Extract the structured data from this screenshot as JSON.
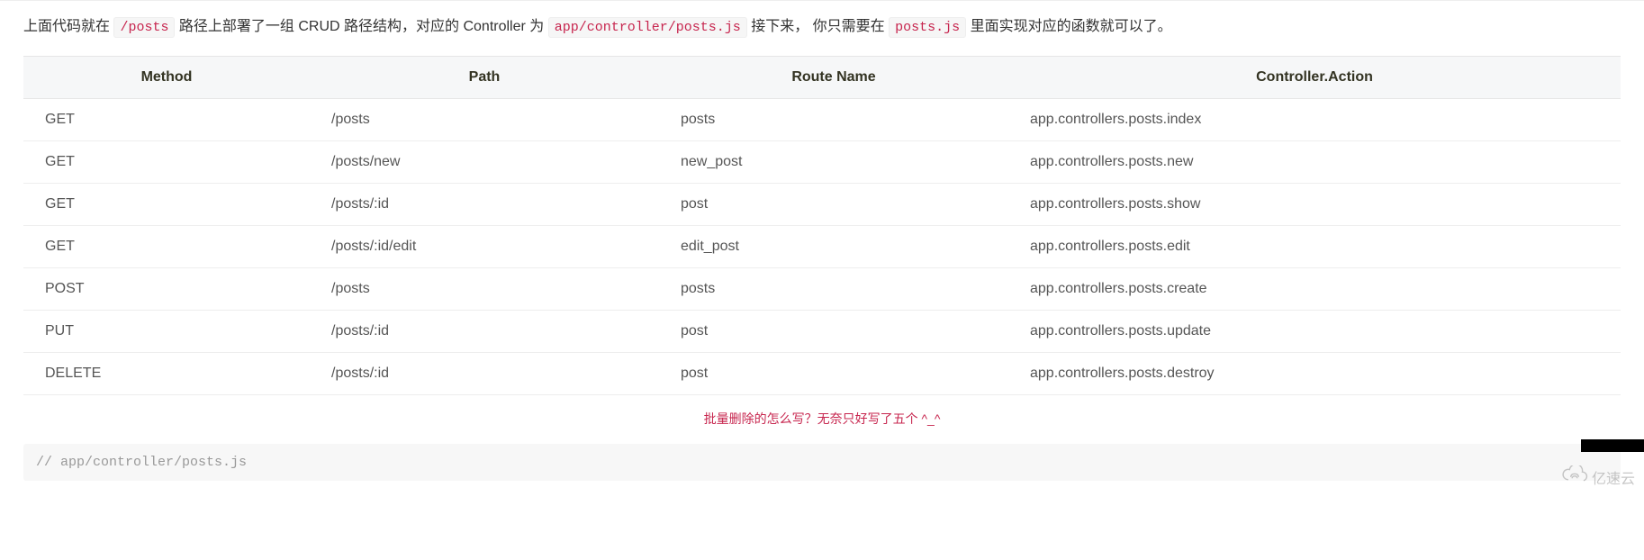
{
  "intro": {
    "pre1": "上面代码就在 ",
    "code1": "/posts",
    "mid1": " 路径上部署了一组 CRUD 路径结构，对应的 Controller 为 ",
    "code2": "app/controller/posts.js",
    "mid2": " 接下来， 你只需要在 ",
    "code3": "posts.js",
    "post": " 里面实现对应的函数就可以了。"
  },
  "table": {
    "headers": [
      "Method",
      "Path",
      "Route Name",
      "Controller.Action"
    ],
    "rows": [
      {
        "method": "GET",
        "path": "/posts",
        "route": "posts",
        "action": "app.controllers.posts.index"
      },
      {
        "method": "GET",
        "path": "/posts/new",
        "route": "new_post",
        "action": "app.controllers.posts.new"
      },
      {
        "method": "GET",
        "path": "/posts/:id",
        "route": "post",
        "action": "app.controllers.posts.show"
      },
      {
        "method": "GET",
        "path": "/posts/:id/edit",
        "route": "edit_post",
        "action": "app.controllers.posts.edit"
      },
      {
        "method": "POST",
        "path": "/posts",
        "route": "posts",
        "action": "app.controllers.posts.create"
      },
      {
        "method": "PUT",
        "path": "/posts/:id",
        "route": "post",
        "action": "app.controllers.posts.update"
      },
      {
        "method": "DELETE",
        "path": "/posts/:id",
        "route": "post",
        "action": "app.controllers.posts.destroy"
      }
    ]
  },
  "note": "批量删除的怎么写？无奈只好写了五个  ^_^",
  "codeblock": {
    "line1": "// app/controller/posts.js"
  },
  "watermark": "亿速云"
}
